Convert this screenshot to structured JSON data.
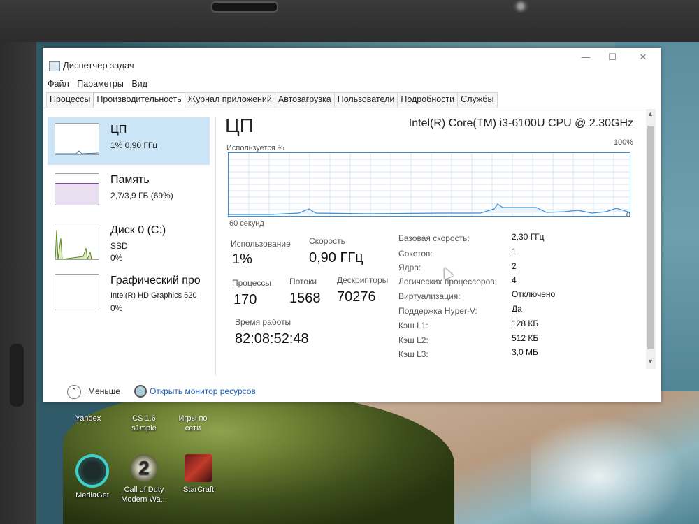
{
  "window": {
    "title": "Диспетчер задач"
  },
  "menu": [
    "Файл",
    "Параметры",
    "Вид"
  ],
  "tabs": [
    "Процессы",
    "Производительность",
    "Журнал приложений",
    "Автозагрузка",
    "Пользователи",
    "Подробности",
    "Службы"
  ],
  "active_tab": "Производительность",
  "sidebar": {
    "items": [
      {
        "title": "ЦП",
        "sub": "1% 0,90 ГГц",
        "sub2": ""
      },
      {
        "title": "Память",
        "sub": "2,7/3,9 ГБ (69%)",
        "sub2": ""
      },
      {
        "title": "Диск 0 (C:)",
        "sub": "SSD",
        "sub2": "0%"
      },
      {
        "title": "Графический про",
        "sub": "Intel(R) HD Graphics 520",
        "sub2": "0%"
      }
    ]
  },
  "main": {
    "title": "ЦП",
    "cpu_model": "Intel(R) Core(TM) i3-6100U CPU @ 2.30GHz",
    "graph": {
      "top_left": "Используется %",
      "top_right": "100%",
      "bottom_left": "60 секунд",
      "bottom_right": "0"
    },
    "stats": {
      "usage_label": "Использование",
      "usage_value": "1%",
      "speed_label": "Скорость",
      "speed_value": "0,90 ГГц",
      "processes_label": "Процессы",
      "processes_value": "170",
      "threads_label": "Потоки",
      "threads_value": "1568",
      "handles_label": "Дескрипторы",
      "handles_value": "70276",
      "uptime_label": "Время работы",
      "uptime_value": "82:08:52:48"
    },
    "specs": [
      {
        "label": "Базовая скорость:",
        "value": "2,30 ГГц"
      },
      {
        "label": "Сокетов:",
        "value": "1"
      },
      {
        "label": "Ядра:",
        "value": "2"
      },
      {
        "label": "Логических процессоров:",
        "value": "4"
      },
      {
        "label": "Виртуализация:",
        "value": "Отключено"
      },
      {
        "label": "Поддержка Hyper-V:",
        "value": "Да"
      },
      {
        "label": "Кэш L1:",
        "value": "128 КБ"
      },
      {
        "label": "Кэш L2:",
        "value": "512 КБ"
      },
      {
        "label": "Кэш L3:",
        "value": "3,0 МБ"
      }
    ]
  },
  "footer": {
    "less_label": "Меньше",
    "monitor_link": "Открыть монитор ресурсов"
  },
  "desktop_icons": [
    {
      "line1": "Yandex",
      "line2": "",
      "name": "yandex"
    },
    {
      "line1": "CS 1.6",
      "line2": "s1mple",
      "name": "cs16"
    },
    {
      "line1": "Игры по",
      "line2": "сети",
      "name": "network-games"
    },
    {
      "line1": "MediaGet",
      "line2": "",
      "name": "mediaget"
    },
    {
      "line1": "Call of Duty",
      "line2": "Modern Wa...",
      "name": "call-of-duty"
    },
    {
      "line1": "StarCraft",
      "line2": "",
      "name": "starcraft"
    }
  ]
}
